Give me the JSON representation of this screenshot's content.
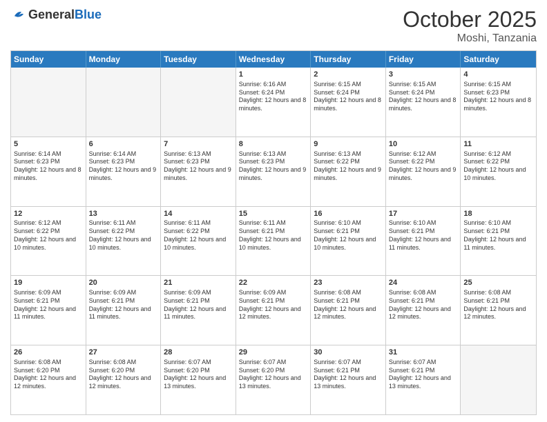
{
  "header": {
    "logo": {
      "general": "General",
      "blue": "Blue"
    },
    "title": "October 2025",
    "location": "Moshi, Tanzania"
  },
  "weekdays": [
    "Sunday",
    "Monday",
    "Tuesday",
    "Wednesday",
    "Thursday",
    "Friday",
    "Saturday"
  ],
  "rows": [
    [
      {
        "day": "",
        "empty": true
      },
      {
        "day": "",
        "empty": true
      },
      {
        "day": "",
        "empty": true
      },
      {
        "day": "1",
        "sunrise": "6:16 AM",
        "sunset": "6:24 PM",
        "daylight": "12 hours and 8 minutes."
      },
      {
        "day": "2",
        "sunrise": "6:15 AM",
        "sunset": "6:24 PM",
        "daylight": "12 hours and 8 minutes."
      },
      {
        "day": "3",
        "sunrise": "6:15 AM",
        "sunset": "6:24 PM",
        "daylight": "12 hours and 8 minutes."
      },
      {
        "day": "4",
        "sunrise": "6:15 AM",
        "sunset": "6:23 PM",
        "daylight": "12 hours and 8 minutes."
      }
    ],
    [
      {
        "day": "5",
        "sunrise": "6:14 AM",
        "sunset": "6:23 PM",
        "daylight": "12 hours and 8 minutes."
      },
      {
        "day": "6",
        "sunrise": "6:14 AM",
        "sunset": "6:23 PM",
        "daylight": "12 hours and 9 minutes."
      },
      {
        "day": "7",
        "sunrise": "6:13 AM",
        "sunset": "6:23 PM",
        "daylight": "12 hours and 9 minutes."
      },
      {
        "day": "8",
        "sunrise": "6:13 AM",
        "sunset": "6:23 PM",
        "daylight": "12 hours and 9 minutes."
      },
      {
        "day": "9",
        "sunrise": "6:13 AM",
        "sunset": "6:22 PM",
        "daylight": "12 hours and 9 minutes."
      },
      {
        "day": "10",
        "sunrise": "6:12 AM",
        "sunset": "6:22 PM",
        "daylight": "12 hours and 9 minutes."
      },
      {
        "day": "11",
        "sunrise": "6:12 AM",
        "sunset": "6:22 PM",
        "daylight": "12 hours and 10 minutes."
      }
    ],
    [
      {
        "day": "12",
        "sunrise": "6:12 AM",
        "sunset": "6:22 PM",
        "daylight": "12 hours and 10 minutes."
      },
      {
        "day": "13",
        "sunrise": "6:11 AM",
        "sunset": "6:22 PM",
        "daylight": "12 hours and 10 minutes."
      },
      {
        "day": "14",
        "sunrise": "6:11 AM",
        "sunset": "6:22 PM",
        "daylight": "12 hours and 10 minutes."
      },
      {
        "day": "15",
        "sunrise": "6:11 AM",
        "sunset": "6:21 PM",
        "daylight": "12 hours and 10 minutes."
      },
      {
        "day": "16",
        "sunrise": "6:10 AM",
        "sunset": "6:21 PM",
        "daylight": "12 hours and 10 minutes."
      },
      {
        "day": "17",
        "sunrise": "6:10 AM",
        "sunset": "6:21 PM",
        "daylight": "12 hours and 11 minutes."
      },
      {
        "day": "18",
        "sunrise": "6:10 AM",
        "sunset": "6:21 PM",
        "daylight": "12 hours and 11 minutes."
      }
    ],
    [
      {
        "day": "19",
        "sunrise": "6:09 AM",
        "sunset": "6:21 PM",
        "daylight": "12 hours and 11 minutes."
      },
      {
        "day": "20",
        "sunrise": "6:09 AM",
        "sunset": "6:21 PM",
        "daylight": "12 hours and 11 minutes."
      },
      {
        "day": "21",
        "sunrise": "6:09 AM",
        "sunset": "6:21 PM",
        "daylight": "12 hours and 11 minutes."
      },
      {
        "day": "22",
        "sunrise": "6:09 AM",
        "sunset": "6:21 PM",
        "daylight": "12 hours and 12 minutes."
      },
      {
        "day": "23",
        "sunrise": "6:08 AM",
        "sunset": "6:21 PM",
        "daylight": "12 hours and 12 minutes."
      },
      {
        "day": "24",
        "sunrise": "6:08 AM",
        "sunset": "6:21 PM",
        "daylight": "12 hours and 12 minutes."
      },
      {
        "day": "25",
        "sunrise": "6:08 AM",
        "sunset": "6:21 PM",
        "daylight": "12 hours and 12 minutes."
      }
    ],
    [
      {
        "day": "26",
        "sunrise": "6:08 AM",
        "sunset": "6:20 PM",
        "daylight": "12 hours and 12 minutes."
      },
      {
        "day": "27",
        "sunrise": "6:08 AM",
        "sunset": "6:20 PM",
        "daylight": "12 hours and 12 minutes."
      },
      {
        "day": "28",
        "sunrise": "6:07 AM",
        "sunset": "6:20 PM",
        "daylight": "12 hours and 13 minutes."
      },
      {
        "day": "29",
        "sunrise": "6:07 AM",
        "sunset": "6:20 PM",
        "daylight": "12 hours and 13 minutes."
      },
      {
        "day": "30",
        "sunrise": "6:07 AM",
        "sunset": "6:21 PM",
        "daylight": "12 hours and 13 minutes."
      },
      {
        "day": "31",
        "sunrise": "6:07 AM",
        "sunset": "6:21 PM",
        "daylight": "12 hours and 13 minutes."
      },
      {
        "day": "",
        "empty": true
      }
    ]
  ]
}
